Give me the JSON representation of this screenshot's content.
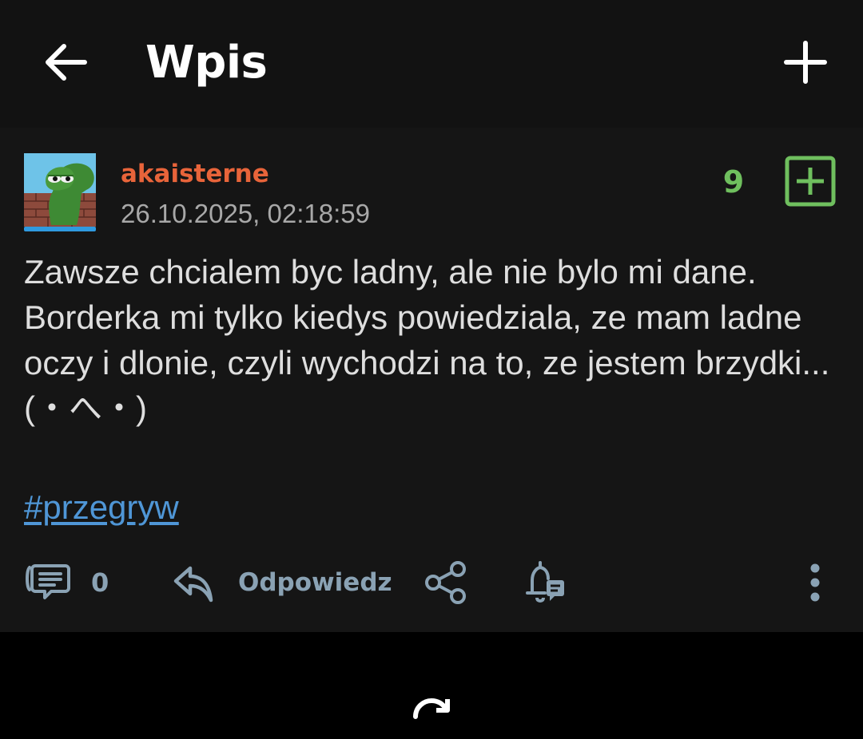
{
  "header": {
    "title": "Wpis",
    "back_icon": "arrow-left-icon",
    "add_icon": "plus-icon"
  },
  "post": {
    "author": "akaisterne",
    "timestamp": "26.10.2025, 02:18:59",
    "votes": "9",
    "body": "Zawsze chcialem byc ladny, ale nie bylo mi dane. Borderka mi tylko kiedys powiedziala, ze mam ladne oczy i dlonie, czyli wychodzi na to, ze jestem brzydki... (・へ・)",
    "tag": "#przegryw",
    "avatar_icon": "avatar-frog-image"
  },
  "actions": {
    "comments_count": "0",
    "reply_label": "Odpowiedz",
    "icons": [
      "comments-icon",
      "reply-icon",
      "share-icon",
      "bell-icon",
      "more-icon"
    ]
  },
  "colors": {
    "username": "#e8643a",
    "vote_green": "#6fbf5e",
    "tag_blue": "#4f96d6",
    "action_gray": "#8aa2b4",
    "header_bg": "#121212",
    "post_bg": "#151515"
  }
}
